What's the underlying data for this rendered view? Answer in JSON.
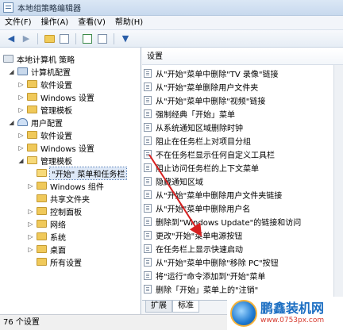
{
  "window": {
    "title": "本地组策略编辑器",
    "app_icon": "policy-editor-icon"
  },
  "menubar": {
    "items": [
      "文件(F)",
      "操作(A)",
      "查看(V)",
      "帮助(H)"
    ]
  },
  "toolbar": {
    "back_icon": "back-arrow-icon",
    "forward_icon": "forward-arrow-icon",
    "up_icon": "up-folder-icon",
    "show_hide_icon": "show-hide-tree-icon",
    "properties_icon": "properties-icon",
    "export_icon": "export-list-icon",
    "help_icon": "help-icon",
    "filter_icon": "filter-icon"
  },
  "tree": {
    "root": "本地计算机 策略",
    "computer_config": "计算机配置",
    "computer_software": "软件设置",
    "computer_windows": "Windows 设置",
    "computer_admin": "管理模板",
    "user_config": "用户配置",
    "user_software": "软件设置",
    "user_windows": "Windows 设置",
    "user_admin": "管理模板",
    "start_menu": "\"开始\" 菜单和任务栏",
    "windows_components": "Windows 组件",
    "shared_folders": "共享文件夹",
    "control_panel": "控制面板",
    "network": "网络",
    "system": "系统",
    "desktop": "桌面",
    "all_settings": "所有设置"
  },
  "settings": {
    "header": "设置",
    "items": [
      "从\"开始\"菜单中删除\"TV 录像\"链接",
      "从\"开始\"菜单删除用户文件夹",
      "从\"开始\"菜单中删除\"视频\"链接",
      "强制经典「开始」菜单",
      "从系统通知区域删除时钟",
      "阻止在任务栏上对项目分组",
      "不在任务栏显示任何自定义工具栏",
      "阻止访问任务栏的上下文菜单",
      "隐藏通知区域",
      "从\"开始\"菜单中删除用户文件夹链接",
      "从\"开始\"菜单中删除用户名",
      "删除到\"Windows Update\"的链接和访问",
      "更改\"开始\"菜单电源按钮",
      "在任务栏上显示快速启动",
      "从\"开始\"菜单中删除\"移除 PC\"按钮",
      "将\"运行\"命令添加到\"开始\"菜单",
      "删除「开始」菜单上的\"注销\""
    ]
  },
  "tabs": {
    "extended": "扩展",
    "standard": "标准"
  },
  "status": {
    "text": "76 个设置"
  },
  "watermark": {
    "main": "鹏鑫装机网",
    "sub": "www.0753px.com"
  },
  "colors": {
    "arrow": "#d62020",
    "selection": "#dde8f7",
    "title_gradient": "#c7d9ee"
  }
}
